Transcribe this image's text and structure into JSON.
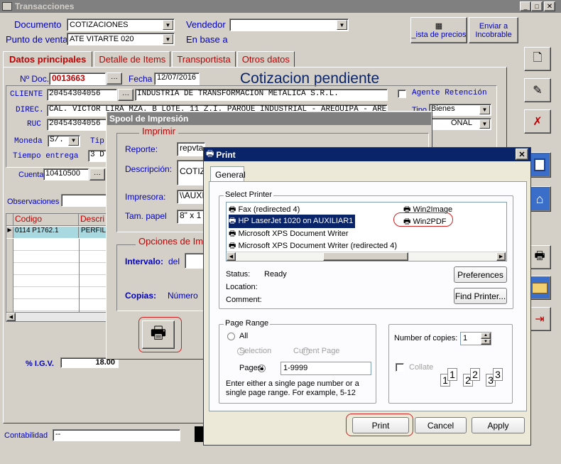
{
  "window": {
    "title": "Transacciones"
  },
  "header": {
    "documento_label": "Documento",
    "documento_value": "COTIZACIONES",
    "vendedor_label": "Vendedor",
    "vendedor_value": "",
    "punto_label": "Punto de venta",
    "punto_value": "ATE VITARTE 020",
    "enbase_label": "En base a",
    "lista_precios": "_ista de precios",
    "enviar_label": "Enviar a Incobrable"
  },
  "tabs": [
    "Datos principales",
    "Detalle de Items",
    "Transportista",
    "Otros datos"
  ],
  "form": {
    "ndoc_label": "Nº Doc.",
    "ndoc_value": "0013663",
    "fecha_label": "Fecha",
    "fecha_value": "12/07/2016",
    "status_title": "Cotizacion pendiente",
    "cliente_label": "CLIENTE",
    "cliente_code": "20454304056",
    "cliente_name": "INDUSTRIA DE TRANSFORMACION METALICA S.R.L.",
    "agente_label": "Agente Retención",
    "direc_label": "DIREC.",
    "direc_value": "CAL. VICTOR LIRA MZA. B LOTE. 11 Z.I. PARQUE INDUSTRIAL - AREQUIPA - AREQUIPA",
    "tipo_label": "Tipo",
    "tipo_value": "Bienes",
    "ruc_label": "RUC",
    "ruc_value": "20454304056",
    "nacional_value": "ONAL",
    "moneda_label": "Moneda",
    "moneda_value": "S/.",
    "tip_label": "Tip",
    "tiempo_label": "Tiempo entrega",
    "tiempo_value": "3 D",
    "cuenta_label": "Cuenta",
    "cuenta_value": "10410500",
    "obs_label": "Observaciones",
    "grid_cols": [
      "Codigo",
      "Descri"
    ],
    "grid_row": {
      "codigo": "0114  P1762.1",
      "desc": "PERFIL"
    },
    "igv_label": "% I.G.V.",
    "igv_value": "18.00",
    "contab_label": "Contabilidad",
    "contab_value": "--"
  },
  "spool": {
    "title": "Spool de Impresión",
    "imprimir": "Imprimir",
    "reporte_label": "Reporte:",
    "reporte_value": "repvta",
    "desc_label": "Descripción:",
    "desc_value": "COTIZ",
    "impresora_label": "Impresora:",
    "impresora_value": "\\\\AUXI",
    "tam_label": "Tam. papel",
    "tam_value": "8\" x 1",
    "opciones": "Opciones de Imp",
    "intervalo": "Intervalo:",
    "del": "del",
    "copias": "Copias:",
    "numero": "Número"
  },
  "print": {
    "title": "Print",
    "tab": "General",
    "select_printer": "Select Printer",
    "printers": [
      "Fax (redirected 4)",
      "HP LaserJet 1020 on AUXILIAR1",
      "Microsoft XPS Document Writer",
      "Microsoft XPS Document Writer (redirected 4)"
    ],
    "printers_right": [
      "Win2Image",
      "Win2PDF"
    ],
    "status_label": "Status:",
    "status_value": "Ready",
    "location_label": "Location:",
    "comment_label": "Comment:",
    "preferences": "Preferences",
    "find_printer": "Find Printer...",
    "page_range": "Page Range",
    "all": "All",
    "selection": "Selection",
    "current_page": "Current Page",
    "pages": "Pages:",
    "pages_value": "1-9999",
    "hint": "Enter either a single page number or a single page range.  For example, 5-12",
    "num_copies": "Number of copies:",
    "copies_value": "1",
    "collate": "Collate",
    "print_btn": "Print",
    "cancel_btn": "Cancel",
    "apply_btn": "Apply"
  },
  "colors": {
    "titlebar": "#0a246a",
    "accent_red": "#c00000",
    "label_blue": "#0000c0"
  }
}
